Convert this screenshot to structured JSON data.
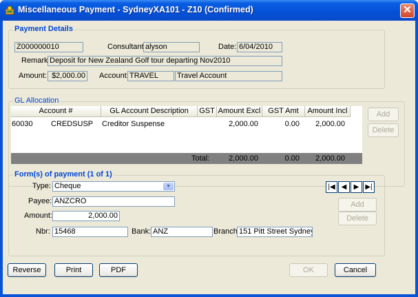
{
  "window": {
    "title": "Miscellaneous Payment - SydneyXA101 - Z10 (Confirmed)"
  },
  "payment_details": {
    "group_label": "Payment Details",
    "code": "Z000000010",
    "consultant_label": "Consultant:",
    "consultant": "alyson",
    "date_label": "Date:",
    "date": "6/04/2010",
    "remark_label": "Remark:",
    "remark": "Deposit for New Zealand Golf tour departing Nov2010",
    "amount_label": "Amount:",
    "amount": "$2,000.00",
    "account_label": "Account:",
    "account_code": "TRAVEL",
    "account_name": "Travel Account"
  },
  "gl_allocation": {
    "group_label": "GL Allocation",
    "columns": [
      "Account #",
      "GL Account Description",
      "GST",
      "Amount Excl",
      "GST Amt",
      "Amount Incl"
    ],
    "rows": [
      {
        "account_num": "60030",
        "account_code": "CREDSUSP",
        "description": "Creditor Suspense",
        "gst": "",
        "amount_excl": "2,000.00",
        "gst_amt": "0.00",
        "amount_incl": "2,000.00"
      }
    ],
    "total_label": "Total:",
    "total_excl": "2,000.00",
    "total_gst": "0.00",
    "total_incl": "2,000.00",
    "add_label": "Add",
    "delete_label": "Delete"
  },
  "forms_of_payment": {
    "group_label": "Form(s) of payment (1 of 1)",
    "type_label": "Type:",
    "type": "Cheque",
    "payee_label": "Payee:",
    "payee": "ANZCRO",
    "amount_label": "Amount:",
    "amount": "2,000.00",
    "nbr_label": "Nbr:",
    "nbr": "15468",
    "bank_label": "Bank:",
    "bank": "ANZ",
    "branch_label": "Branch:",
    "branch": "151 Pitt Street Sydney",
    "add_label": "Add",
    "delete_label": "Delete",
    "nav": {
      "first": "first-record",
      "prev": "previous-record",
      "next": "next-record",
      "last": "last-record"
    }
  },
  "footer": {
    "reverse_label": "Reverse",
    "print_label": "Print",
    "pdf_label": "PDF",
    "ok_label": "OK",
    "cancel_label": "Cancel"
  }
}
